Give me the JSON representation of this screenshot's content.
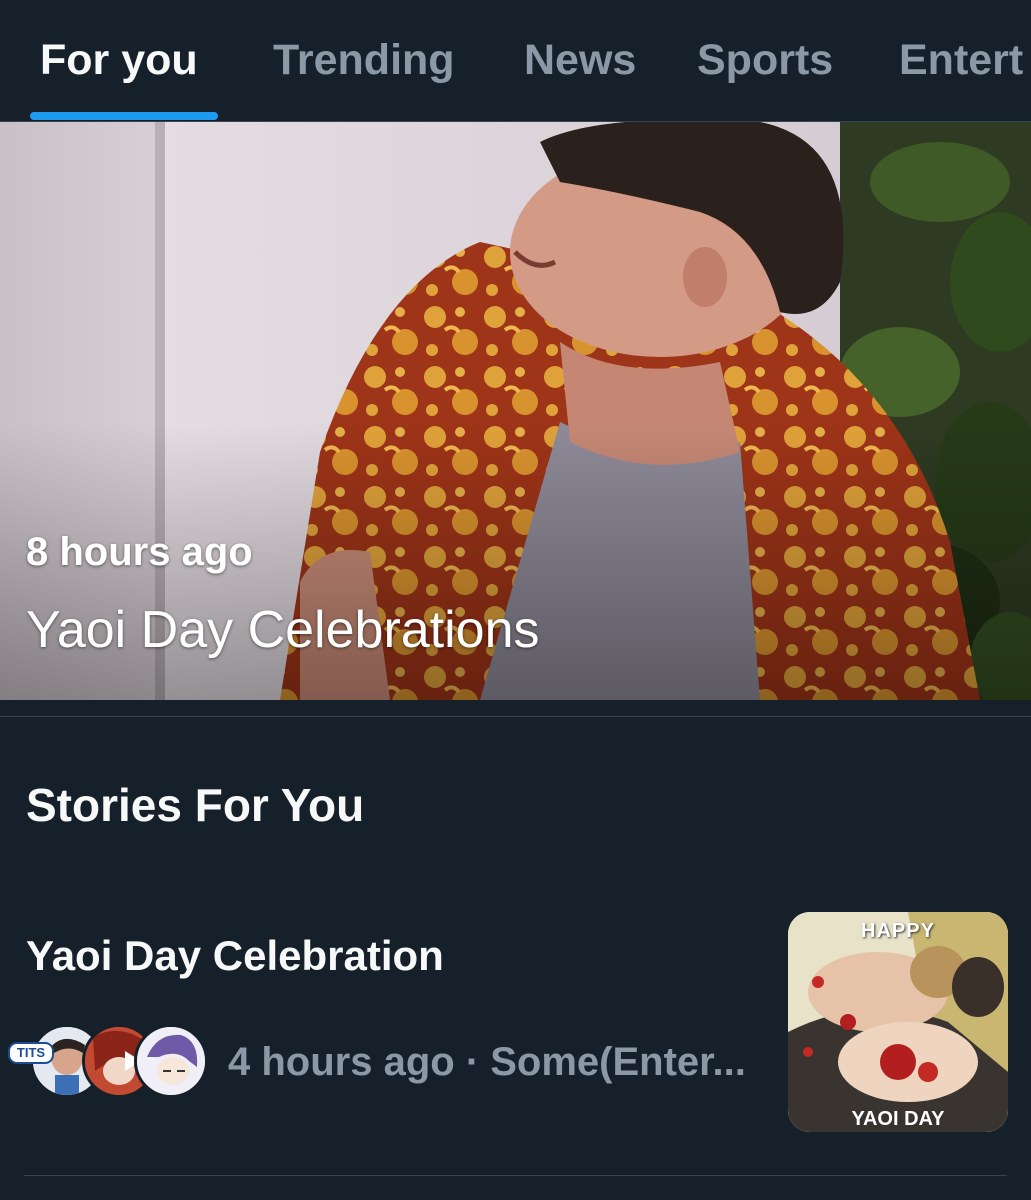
{
  "tabs": [
    {
      "label": "For you",
      "active": true
    },
    {
      "label": "Trending",
      "active": false
    },
    {
      "label": "News",
      "active": false
    },
    {
      "label": "Sports",
      "active": false
    },
    {
      "label": "Entert",
      "active": false
    }
  ],
  "hero": {
    "time": "8 hours ago",
    "title": "Yaoi Day Celebrations"
  },
  "stories_section": {
    "title": "Stories For You"
  },
  "story": {
    "title": "Yaoi Day Celebration",
    "meta": "4 hours ago · Some(Enter...",
    "avatar_badge": "TITS",
    "thumbnail": {
      "top_text": "HAPPY",
      "bottom_text": "YAOI DAY"
    }
  },
  "colors": {
    "background": "#15202b",
    "accent": "#1d9bf0",
    "muted_text": "#8b98a5",
    "divider": "#38444d"
  }
}
